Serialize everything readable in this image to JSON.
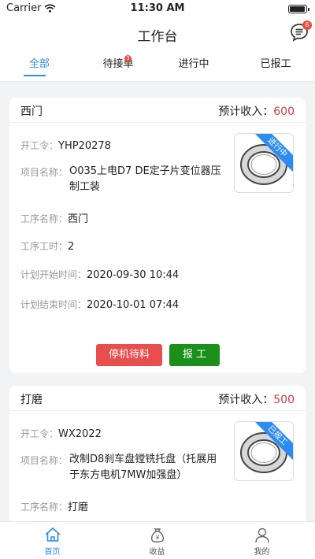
{
  "status_bar": {
    "carrier": "Carrier",
    "time": "11:30 AM",
    "battery_level": 0.95
  },
  "header": {
    "title": "工作台",
    "message_icon": "message-icon",
    "message_badge": "6"
  },
  "tabs": [
    {
      "label": "全部",
      "active": true
    },
    {
      "label": "待接单",
      "badge": "3"
    },
    {
      "label": "进行中"
    },
    {
      "label": "已报工"
    }
  ],
  "labels": {
    "income": "预计收入：",
    "work_order": "开工令：",
    "project_name": "项目名称：",
    "process_name": "工序名称：",
    "process_hours": "工序工时：",
    "plan_start": "计划开始时间：",
    "plan_end": "计划结束时间："
  },
  "cards": [
    {
      "name": "西门",
      "income": "600",
      "work_order": "YHP20278",
      "project_name": "O035上电D7 DE定子片变位器压制工装",
      "process_name": "西门",
      "process_hours": "2",
      "plan_start": "2020-09-30 10:44",
      "plan_end": "2020-10-01 07:44",
      "status": "进行中",
      "actions": [
        "停机待料",
        "报 工"
      ]
    },
    {
      "name": "打磨",
      "income": "500",
      "work_order": "WX2022",
      "project_name": "改制D8刹车盘镗铣托盘（托展用于东方电机7MW加强盘）",
      "process_name": "打磨",
      "status": "已报工"
    }
  ],
  "bottom_tabs": [
    {
      "label": "首页",
      "icon": "home-icon",
      "active": true
    },
    {
      "label": "收益",
      "icon": "money-bag-icon"
    },
    {
      "label": "我的",
      "icon": "user-icon"
    }
  ],
  "colors": {
    "accent": "#2d8cf0",
    "income": "#d0393d",
    "danger_button": "#e94e4e",
    "success_button": "#1a8f1a",
    "badge": "#e74c3c"
  }
}
